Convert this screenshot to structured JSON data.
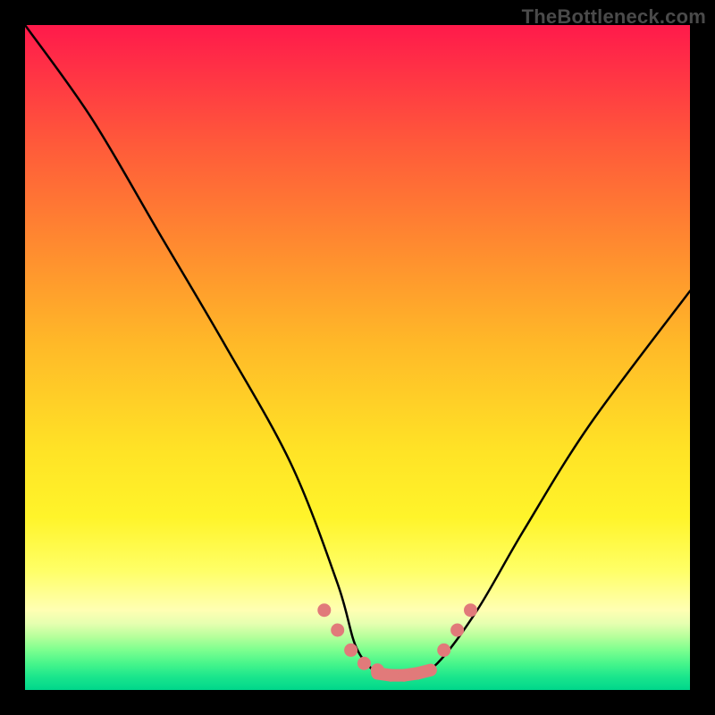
{
  "attribution": "TheBottleneck.com",
  "colors": {
    "frame": "#000000",
    "curve": "#000000",
    "bead": "#e17a7a",
    "gradient_top": "#ff1a4b",
    "gradient_bottom": "#00d68b"
  },
  "chart_data": {
    "type": "line",
    "title": "",
    "xlabel": "",
    "ylabel": "",
    "xlim": [
      0,
      100
    ],
    "ylim": [
      0,
      100
    ],
    "note": "V-shaped bottleneck curve over vertical color gradient (red=high bottleneck, green=low). No numeric axis ticks rendered. Values are estimated from pixel positions.",
    "series": [
      {
        "name": "bottleneck-curve",
        "x": [
          0,
          10,
          20,
          30,
          40,
          47,
          50,
          54,
          58,
          62,
          68,
          75,
          85,
          100
        ],
        "y": [
          100,
          86,
          69,
          52,
          34,
          16,
          6,
          2,
          2,
          4,
          12,
          24,
          40,
          60
        ]
      }
    ],
    "markers": [
      {
        "name": "left-beads",
        "x": [
          45,
          47,
          49,
          51,
          53
        ],
        "y": [
          12,
          9,
          6,
          4,
          3
        ]
      },
      {
        "name": "floor-beads",
        "x": [
          53,
          55,
          57,
          59,
          61
        ],
        "y": [
          2.5,
          2.2,
          2.2,
          2.5,
          3
        ]
      },
      {
        "name": "right-beads",
        "x": [
          63,
          65,
          67
        ],
        "y": [
          6,
          9,
          12
        ]
      }
    ]
  }
}
